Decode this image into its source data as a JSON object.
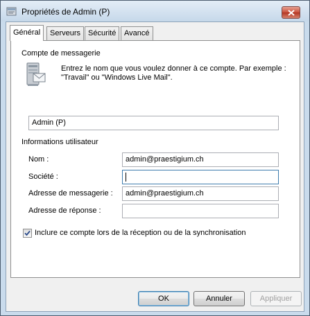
{
  "window": {
    "title": "Propriétés de Admin (P)"
  },
  "tabs": [
    {
      "label": "Général",
      "active": true
    },
    {
      "label": "Serveurs",
      "active": false
    },
    {
      "label": "Sécurité",
      "active": false
    },
    {
      "label": "Avancé",
      "active": false
    }
  ],
  "mail_account": {
    "group_label": "Compte de messagerie",
    "instruction": "Entrez le nom que vous voulez donner à ce compte. Par exemple : \"Travail\" ou \"Windows Live Mail\".",
    "account_name_value": "Admin (P)"
  },
  "user_info": {
    "group_label": "Informations utilisateur",
    "name_label": "Nom :",
    "name_value": "admin@praestigium.ch",
    "company_label": "Société :",
    "company_value": "",
    "email_label": "Adresse de messagerie :",
    "email_value": "admin@praestigium.ch",
    "reply_label": "Adresse de réponse :",
    "reply_value": ""
  },
  "options": {
    "include_label": "Inclure ce compte lors de la réception ou de la synchronisation",
    "include_checked": true
  },
  "buttons": {
    "ok": "OK",
    "cancel": "Annuler",
    "apply": "Appliquer"
  },
  "colors": {
    "frame": "#c9dbec",
    "focus_border": "#3d7bad",
    "close_button": "#c8503a"
  }
}
